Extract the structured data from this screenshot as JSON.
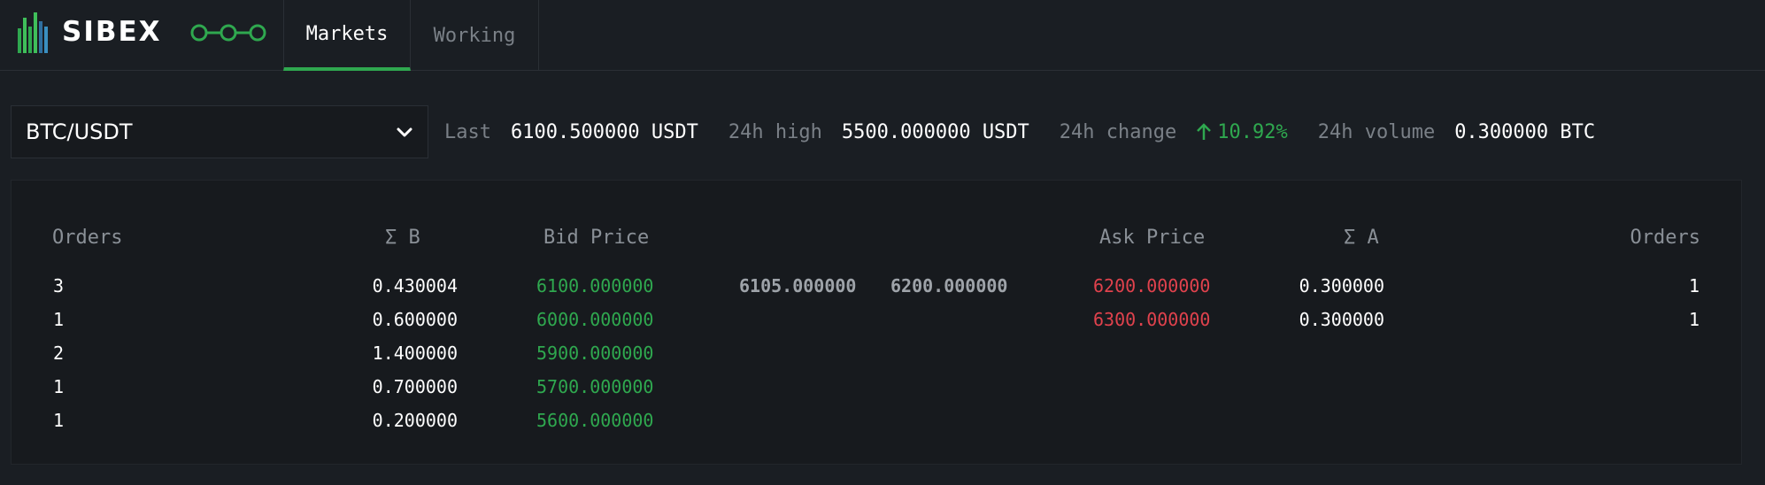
{
  "brand": {
    "name": "SIBEX",
    "bar_colors": [
      "#2fa84f",
      "#3fbf5a",
      "#2fa84f",
      "#3fbf5a",
      "#2f6f9f",
      "#3a8fc0"
    ]
  },
  "nav": {
    "tabs": [
      {
        "label": "Markets",
        "active": true
      },
      {
        "label": "Working",
        "active": false
      }
    ],
    "link_icon": "chain-link-icon"
  },
  "market": {
    "pair": "BTC/USDT",
    "last_label": "Last",
    "last_value": "6100.500000 USDT",
    "high_label": "24h high",
    "high_value": "5500.000000 USDT",
    "change_label": "24h change",
    "change_value": "10.92%",
    "change_direction": "up",
    "volume_label": "24h volume",
    "volume_value": "0.300000 BTC"
  },
  "orderbook": {
    "headers": {
      "bid_orders": "Orders",
      "sum_b": "Σ B",
      "bid_price": "Bid Price",
      "ask_price": "Ask Price",
      "sum_a": "Σ A",
      "ask_orders": "Orders"
    },
    "bids": [
      {
        "orders": "3",
        "sum": "0.430004",
        "price": "6100.000000"
      },
      {
        "orders": "1",
        "sum": "0.600000",
        "price": "6000.000000"
      },
      {
        "orders": "2",
        "sum": "1.400000",
        "price": "5900.000000"
      },
      {
        "orders": "1",
        "sum": "0.700000",
        "price": "5700.000000"
      },
      {
        "orders": "1",
        "sum": "0.200000",
        "price": "5600.000000"
      }
    ],
    "mid_prices": [
      "6105.000000",
      "6200.000000"
    ],
    "asks": [
      {
        "price": "6200.000000",
        "sum": "0.300000",
        "orders": "1"
      },
      {
        "price": "6300.000000",
        "sum": "0.300000",
        "orders": "1"
      }
    ],
    "colors": {
      "bid": "#2fa84f",
      "ask": "#e0424d"
    }
  }
}
